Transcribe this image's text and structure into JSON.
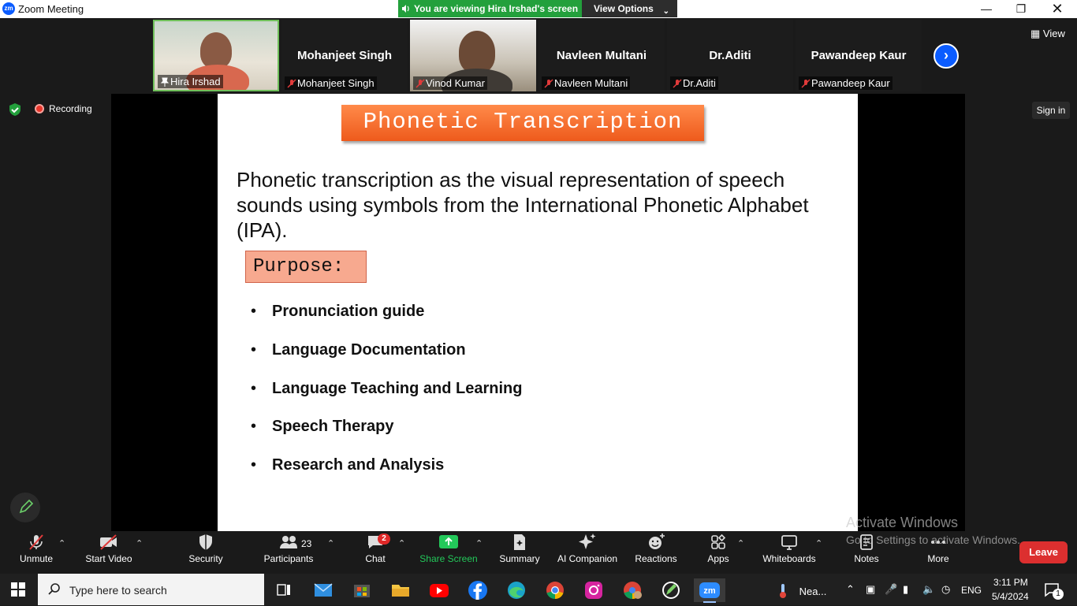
{
  "window": {
    "title": "Zoom Meeting",
    "logo": "zm",
    "banner": "You are viewing Hira Irshad's screen",
    "view_options": "View Options"
  },
  "participants_strip": {
    "tiles": [
      {
        "name": "Hira Irshad",
        "type": "video",
        "pinned": true
      },
      {
        "name": "Mohanjeet Singh",
        "type": "name",
        "muted": true
      },
      {
        "name": "Vinod Kumar",
        "type": "video",
        "muted": true
      },
      {
        "name": "Navleen Multani",
        "type": "name",
        "muted": true
      },
      {
        "name": "Dr.Aditi",
        "type": "name",
        "muted": true
      },
      {
        "name": "Pawandeep Kaur",
        "type": "name",
        "muted": true
      }
    ],
    "view_label": "View"
  },
  "meeting": {
    "recording_label": "Recording",
    "sign_in": "Sign in"
  },
  "slide": {
    "title": "Phonetic Transcription",
    "paragraph": "Phonetic transcription as the visual representation of speech sounds using symbols from the International Phonetic Alphabet (IPA).",
    "purpose_label": "Purpose:",
    "bullets": [
      "Pronunciation guide",
      "Language Documentation",
      "Language Teaching and Learning",
      "Speech Therapy",
      "Research and Analysis"
    ]
  },
  "toolbar": {
    "unmute": "Unmute",
    "start_video": "Start Video",
    "security": "Security",
    "participants": "Participants",
    "participants_count": "23",
    "chat": "Chat",
    "chat_badge": "2",
    "share_screen": "Share Screen",
    "summary": "Summary",
    "ai_companion": "AI Companion",
    "reactions": "Reactions",
    "apps": "Apps",
    "whiteboards": "Whiteboards",
    "notes": "Notes",
    "more": "More",
    "leave": "Leave",
    "share_color": "#23c85a",
    "leave_color": "#dc2f2f"
  },
  "watermark": {
    "line1": "Activate Windows",
    "line2": "Go to Settings to activate Windows."
  },
  "taskbar": {
    "search_placeholder": "Type here to search",
    "weather": "Nea...",
    "language": "ENG",
    "time": "3:11 PM",
    "date": "5/4/2024",
    "notification_count": "1",
    "apps": [
      "task-view",
      "mail",
      "store",
      "file-explorer",
      "youtube",
      "facebook",
      "edge",
      "chrome",
      "instagram",
      "chrome-profile",
      "pen-app",
      "zoom"
    ]
  }
}
